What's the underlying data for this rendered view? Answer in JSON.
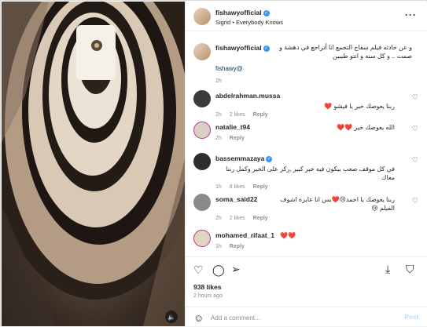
{
  "post": {
    "username": "fishawyofficial",
    "audio": "Sigrid • Everybody Knows",
    "more_icon": "more-horizontal-icon"
  },
  "caption": {
    "username": "fishawyofficial",
    "text": "و عن حادثه فيلم سفاح التجمع انا أتراجع في دهشة و صمت .. و كل سنه و انتو طيبين",
    "tag": "fishawy@",
    "time": "2h"
  },
  "comments": [
    {
      "username": "abdelrahman.mussa",
      "text": "ربنا يعوضك خير يا فيشو ❤️",
      "time": "2h",
      "likes": "2 likes",
      "reply": "Reply"
    },
    {
      "username": "natalie_t94",
      "text": "الله يعوضك خير ❤️❤️",
      "time": "2h",
      "likes": "",
      "reply": "Reply"
    },
    {
      "username": "bassemmazaya",
      "text": "في كل موقف صعب بيكون فيه خير كبير ,ركز على الخير وكمل ربنا معاك",
      "time": "1h",
      "likes": "8 likes",
      "reply": "Reply"
    },
    {
      "username": "soma_said22",
      "text": "ربنا يعوضك يا احمد😢❤️بس انا عايزة اشوف الفيلم 😢",
      "time": "2h",
      "likes": "2 likes",
      "reply": "Reply"
    },
    {
      "username": "mohamed_rifaat_1",
      "text": "❤️❤️",
      "time": "1h",
      "likes": "",
      "reply": "Reply"
    }
  ],
  "actions": {
    "likes": "938 likes",
    "ago": "2 hours ago"
  },
  "add_comment": {
    "placeholder": "Add a comment...",
    "post": "Post"
  }
}
